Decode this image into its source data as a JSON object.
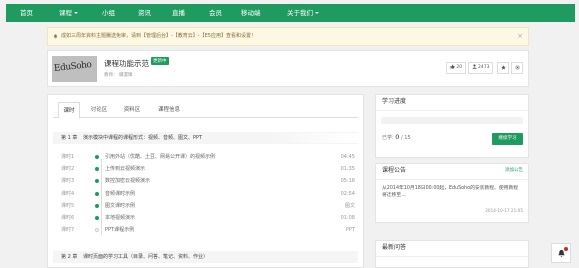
{
  "nav": {
    "items": [
      {
        "label": "首页",
        "caret": false
      },
      {
        "label": "课程",
        "caret": true
      },
      {
        "label": "小组",
        "caret": false
      },
      {
        "label": "资讯",
        "caret": false
      },
      {
        "label": "直播",
        "caret": false
      },
      {
        "label": "会员",
        "caret": false
      },
      {
        "label": "移动端",
        "caret": false
      },
      {
        "label": "关于我们",
        "caret": true
      }
    ]
  },
  "alert": {
    "text": "成如三周年資料主题騰送免审，请到【管理后台】-【教育云】-【E5应用】查看和设置！",
    "close": "×"
  },
  "course": {
    "cover_text": "EduSoho",
    "title": "课程功能示范",
    "badge": "更新中",
    "teacher": "教师：  爛漫輝",
    "likes": "20",
    "students": "2473"
  },
  "tabs": [
    "课时",
    "讨论区",
    "资料区",
    "课程信息"
  ],
  "chapters": [
    {
      "num": "第 1 章",
      "title": "演示模块中课程的课程形式：视频、音频、图文、PPT"
    },
    {
      "num": "第 2 章",
      "title": "课时页面的学习工具（目录、问答、笔记、资料、作业）"
    }
  ],
  "lessons": [
    {
      "no": "课时1",
      "title": "引用外站（优酷、土豆、网易公开课）的视频示例",
      "time": "04:45",
      "done": true
    },
    {
      "no": "课时2",
      "title": "上传到云视频演示",
      "time": "01:35",
      "done": true
    },
    {
      "no": "课时3",
      "title": "数控加密云视频演示",
      "time": "05:18",
      "done": true
    },
    {
      "no": "课时4",
      "title": "音频课时示例",
      "time": "02:54",
      "done": true
    },
    {
      "no": "课时5",
      "title": "图文课时示例",
      "time": "图文",
      "done": true
    },
    {
      "no": "课时6",
      "title": "本地视频演示",
      "time": "01:08",
      "done": true
    },
    {
      "no": "课时7",
      "title": "PPT课程示例",
      "time": "PPT",
      "done": false
    }
  ],
  "progress": {
    "heading": "学习进度",
    "learned_label": "已学:",
    "learned": "0",
    "total": "/ 15",
    "value": 0,
    "button": "继续学习"
  },
  "announcement": {
    "heading": "课程公告",
    "link": "添加公告",
    "body": "从2014年10月18日00:00起，EduSoho的安装教程、使用教程将迁移至...",
    "time": "2014-10-17 21:05"
  },
  "latest": {
    "heading": "最新问答"
  },
  "colors": {
    "brand": "#1f9b60",
    "alert_bg": "#fcf8e3"
  }
}
